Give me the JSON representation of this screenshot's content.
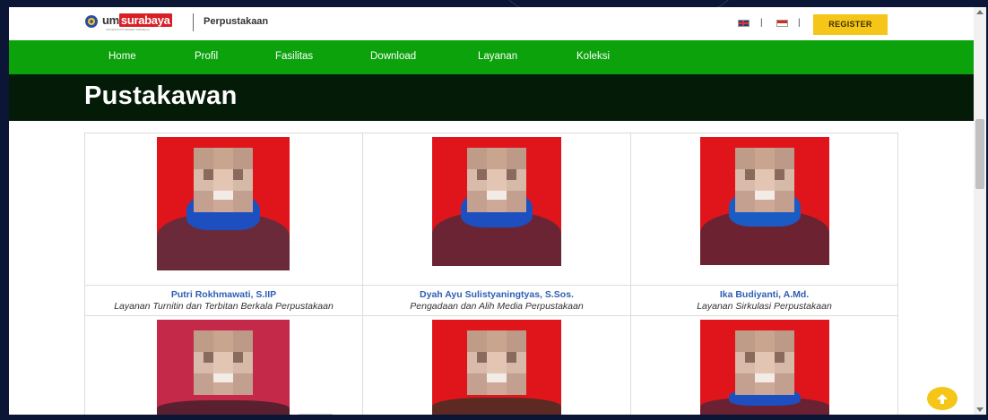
{
  "header": {
    "logo_prefix": "um",
    "logo_brand": "surabaya",
    "logo_subtitle": "UNIVERSITAS NEGERI SURABAYA",
    "site_name": "Perpustakaan",
    "register_label": "REGISTER",
    "lang_separator": "|"
  },
  "nav": {
    "items": [
      {
        "label": "Home"
      },
      {
        "label": "Profil"
      },
      {
        "label": "Fasilitas"
      },
      {
        "label": "Download"
      },
      {
        "label": "Layanan"
      },
      {
        "label": "Koleksi"
      }
    ]
  },
  "page": {
    "title": "Pustakawan"
  },
  "staff": [
    {
      "name": "Putri Rokhmawati, S.IIP",
      "role": "Layanan Turnitin dan Terbitan Berkala Perpustakaan"
    },
    {
      "name": "Dyah Ayu Sulistyaningtyas, S.Sos.",
      "role": "Pengadaan dan Alih Media Perpustakaan"
    },
    {
      "name": "Ika Budiyanti, A.Md.",
      "role": "Layanan Sirkulasi Perpustakaan"
    }
  ],
  "colors": {
    "nav_green": "#0ca20c",
    "title_band": "#041b08",
    "register_yellow": "#f5c518",
    "name_blue": "#2f5fb3",
    "photo_red": "#e0151c"
  }
}
